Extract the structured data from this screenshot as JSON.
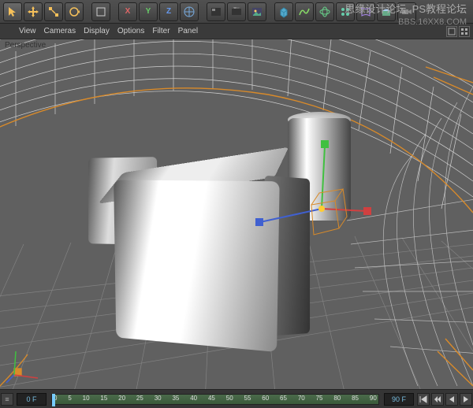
{
  "toolbar": {
    "tools": [
      {
        "name": "select-tool",
        "icon": "cursor",
        "active": true
      },
      {
        "name": "move-tool",
        "icon": "move"
      },
      {
        "name": "scale-tool",
        "icon": "scale"
      },
      {
        "name": "rotate-tool",
        "icon": "rotate"
      }
    ],
    "axis_buttons": [
      {
        "name": "axis-x",
        "label": "X"
      },
      {
        "name": "axis-y",
        "label": "Y"
      },
      {
        "name": "axis-z",
        "label": "Z"
      }
    ],
    "right_tools": [
      {
        "name": "render-region",
        "icon": "render"
      },
      {
        "name": "render-view",
        "icon": "clapper"
      },
      {
        "name": "picture-viewer",
        "icon": "picture"
      },
      {
        "name": "add-cube",
        "icon": "cube"
      },
      {
        "name": "add-spline",
        "icon": "spline"
      },
      {
        "name": "add-nurbs",
        "icon": "nurbs"
      },
      {
        "name": "add-array",
        "icon": "array"
      },
      {
        "name": "add-deformer",
        "icon": "deformer"
      },
      {
        "name": "add-environment",
        "icon": "env"
      },
      {
        "name": "add-camera",
        "icon": "camera"
      }
    ]
  },
  "menubar": {
    "items": [
      "View",
      "Cameras",
      "Display",
      "Options",
      "Filter",
      "Panel"
    ]
  },
  "viewport": {
    "label": "Perspective",
    "camera_path_color": "#d88a2a",
    "grid_color": "#8a8a8a",
    "bg_color": "#606060",
    "objects": [
      "cube",
      "cube-small",
      "cylinder",
      "sweep-surface"
    ],
    "gizmo_axes": {
      "x": "#d04040",
      "y": "#40c040",
      "z": "#4060d0"
    }
  },
  "timeline": {
    "start_frame": "0",
    "end_frame": "90",
    "current_frame": "0 F",
    "end_display": "90 F",
    "ticks": [
      "0",
      "5",
      "10",
      "15",
      "20",
      "25",
      "30",
      "35",
      "40",
      "45",
      "50",
      "55",
      "60",
      "65",
      "70",
      "75",
      "80",
      "85",
      "90"
    ],
    "transport": [
      {
        "name": "goto-start",
        "icon": "|<"
      },
      {
        "name": "step-back",
        "icon": "<<"
      },
      {
        "name": "play-back",
        "icon": "<"
      },
      {
        "name": "play-forward",
        "icon": ">"
      }
    ]
  },
  "watermark": {
    "line1_left": "思缘设计论坛",
    "line1_right": "PS教程论坛",
    "line2": "BBS.16XX8.COM"
  }
}
